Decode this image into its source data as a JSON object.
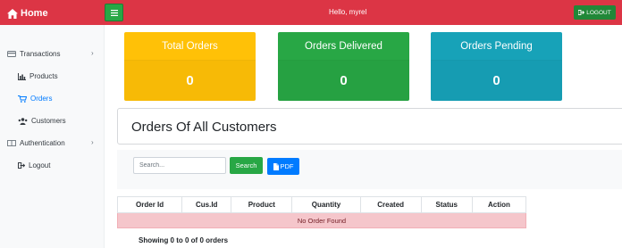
{
  "header": {
    "brand": "Home",
    "greeting": "Hello, myrel",
    "logout_label": "LOGOUT"
  },
  "sidebar": {
    "items": [
      {
        "label": "Transactions",
        "icon": "credit-card-icon"
      },
      {
        "label": "Products",
        "icon": "bar-chart-icon"
      },
      {
        "label": "Orders",
        "icon": "cart-icon",
        "active": true
      },
      {
        "label": "Customers",
        "icon": "users-icon"
      },
      {
        "label": "Authentication",
        "icon": "columns-icon"
      },
      {
        "label": "Logout",
        "icon": "sign-out-icon"
      }
    ]
  },
  "cards": [
    {
      "title": "Total Orders",
      "value": "0",
      "color": "#ffc107"
    },
    {
      "title": "Orders Delivered",
      "value": "0",
      "color": "#28a745"
    },
    {
      "title": "Orders Pending",
      "value": "0",
      "color": "#17a2b8"
    }
  ],
  "main": {
    "section_title": "Orders Of All Customers",
    "search": {
      "placeholder": "Search...",
      "value": "",
      "button_label": "Search"
    },
    "pdf_label": "PDF",
    "table": {
      "columns": [
        "Order Id",
        "Cus.Id",
        "Product",
        "Quantity",
        "Created",
        "Status",
        "Action"
      ],
      "empty_message": "No Order Found"
    },
    "showing": "Showing 0 to 0 of 0 orders"
  },
  "colors": {
    "topbar": "#dc3545",
    "accent_green": "#28a745",
    "accent_blue": "#007bff",
    "empty_row": "#f5c6cb"
  }
}
